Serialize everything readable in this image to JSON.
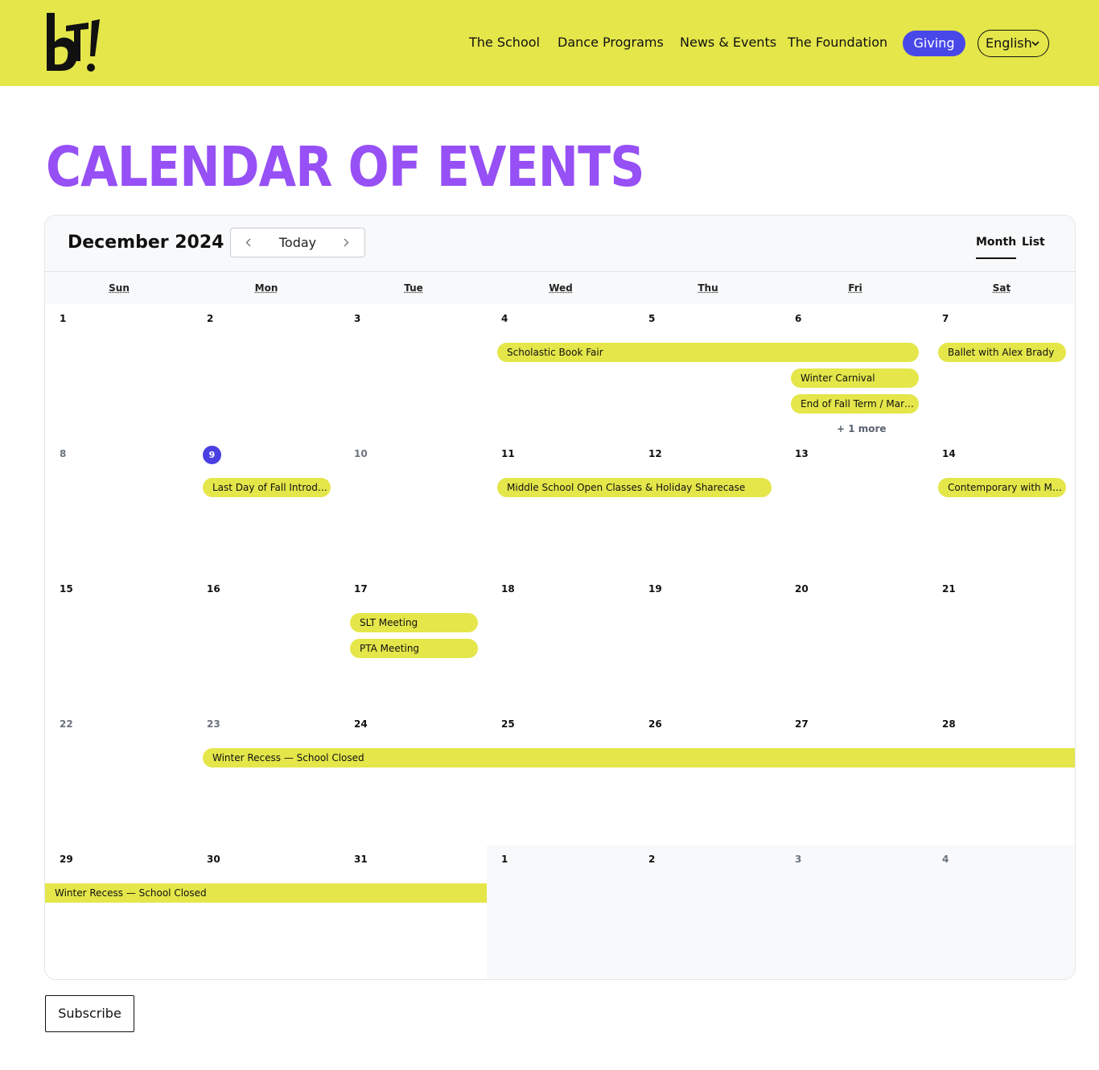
{
  "colors": {
    "header_bg": "#e4e64a",
    "accent_purple": "#9650f5",
    "giving_blue": "#4848e8",
    "event_yellow": "#e4e64a",
    "today_circle": "#4a3fe2"
  },
  "header": {
    "logo_alt": "bT!",
    "nav": [
      "The School",
      "Dance Programs",
      "News & Events",
      "The Foundation"
    ],
    "giving": "Giving",
    "language": "English",
    "language_icon": "chevron-down-icon"
  },
  "page_title": "CALENDAR OF EVENTS",
  "calendar": {
    "month_title": "December 2024",
    "today_label": "Today",
    "prev_icon": "chevron-left-icon",
    "next_icon": "chevron-right-icon",
    "views": [
      "Month",
      "List"
    ],
    "active_view": "Month",
    "weekdays": [
      "Sun",
      "Mon",
      "Tue",
      "Wed",
      "Thu",
      "Fri",
      "Sat"
    ],
    "weeks": [
      [
        1,
        2,
        3,
        4,
        5,
        6,
        7
      ],
      [
        8,
        9,
        10,
        11,
        12,
        13,
        14
      ],
      [
        15,
        16,
        17,
        18,
        19,
        20,
        21
      ],
      [
        22,
        23,
        24,
        25,
        26,
        27,
        28
      ],
      [
        29,
        30,
        31,
        1,
        2,
        3,
        4
      ]
    ],
    "today_date": "9",
    "events": {
      "book_fair": "Scholastic Book Fair",
      "ballet": "Ballet with Alex Brady",
      "winter_carnival": "Winter Carnival",
      "end_fall_term": "End of Fall Term / Marki...",
      "more": "+ 1 more",
      "last_day_fall": "Last Day of Fall Introdu...",
      "middle_school": "Middle School Open Classes & Holiday Sharecase",
      "contemporary": "Contemporary with Ma...",
      "slt": "SLT Meeting",
      "pta": "PTA Meeting",
      "winter_recess_1": "Winter Recess — School Closed",
      "winter_recess_2": "Winter Recess — School Closed"
    }
  },
  "subscribe": "Subscribe"
}
